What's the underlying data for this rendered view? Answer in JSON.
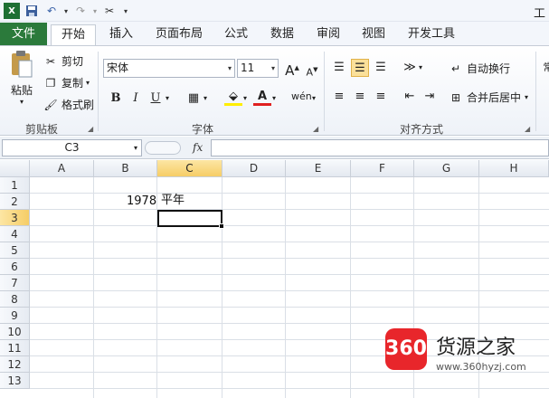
{
  "quick_access": {
    "save_icon": "save-icon",
    "undo_icon": "undo-icon",
    "redo_icon": "redo-icon",
    "customize_icon": "customize-icon",
    "title_partial": "工"
  },
  "tabs": [
    {
      "label": "文件"
    },
    {
      "label": "开始"
    },
    {
      "label": "插入"
    },
    {
      "label": "页面布局"
    },
    {
      "label": "公式"
    },
    {
      "label": "数据"
    },
    {
      "label": "审阅"
    },
    {
      "label": "视图"
    },
    {
      "label": "开发工具"
    }
  ],
  "ribbon": {
    "clipboard": {
      "paste": "粘贴",
      "cut": "剪切",
      "copy": "复制",
      "format_painter": "格式刷",
      "group_label": "剪贴板"
    },
    "font": {
      "font_name": "宋体",
      "font_size": "11",
      "bold": "B",
      "italic": "I",
      "underline": "U",
      "grow": "A",
      "shrink": "A",
      "group_label": "字体"
    },
    "alignment": {
      "wrap_text": "自动换行",
      "merge_center": "合并后居中",
      "group_label": "对齐方式"
    }
  },
  "formula_bar": {
    "name_box": "C3",
    "fx": "fx",
    "formula": ""
  },
  "grid": {
    "columns": [
      "A",
      "B",
      "C",
      "D",
      "E",
      "F",
      "G",
      "H"
    ],
    "rows": [
      "1",
      "2",
      "3",
      "4",
      "5",
      "6",
      "7",
      "8",
      "9",
      "10",
      "11",
      "12",
      "13"
    ],
    "selected_column": "C",
    "selected_row": "3",
    "cells": {
      "B2": "1978",
      "C2": "平年"
    }
  },
  "watermark": {
    "badge": "360",
    "name": "货源之家",
    "url": "www.360hyzj.com"
  },
  "colors": {
    "file_tab": "#2b7a3b",
    "selected_header": "#f6cd66",
    "watermark_red": "#e8262b"
  }
}
